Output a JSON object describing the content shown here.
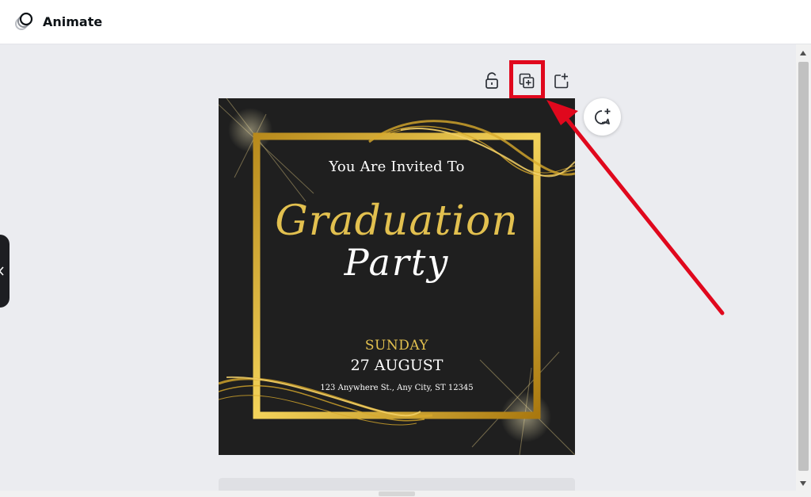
{
  "header": {
    "animate_label": "Animate",
    "animate_icon": "animate-icon"
  },
  "page_toolbar": {
    "lock_icon": "unlock-icon",
    "duplicate_icon": "duplicate-page-icon",
    "add_icon": "add-page-icon",
    "comment_icon": "add-comment-icon"
  },
  "design": {
    "line1": "You Are Invited To",
    "title_script": "Graduation",
    "subtitle_script": "Party",
    "day": "SUNDAY",
    "date": "27 AUGUST",
    "address": "123 Anywhere St., Any City, ST 12345"
  },
  "colors": {
    "gold": "#e2c04f",
    "highlight": "#e0081d",
    "design_bg": "#1f1f1f"
  }
}
